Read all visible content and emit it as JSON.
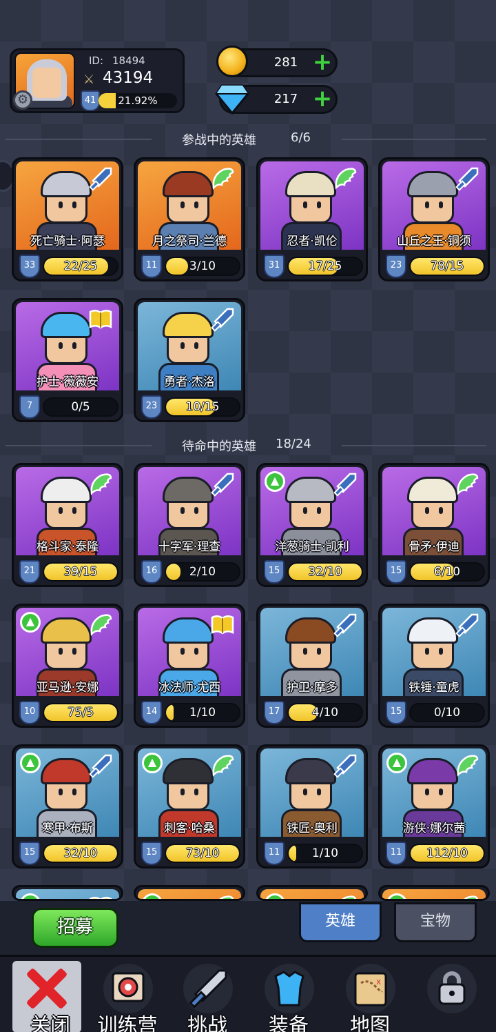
{
  "player": {
    "id_label": "ID:",
    "id": "18494",
    "power": "43194",
    "level": "41",
    "exp_text": "21.92%",
    "exp_fraction": 0.2192
  },
  "currency": {
    "coins": "281",
    "gems": "217",
    "add_symbol": "+"
  },
  "sections": {
    "active": {
      "title": "参战中的英雄",
      "count": "6/6"
    },
    "standby": {
      "title": "待命中的英雄",
      "count": "18/24"
    }
  },
  "active_heroes": [
    {
      "name": "死亡骑士·阿瑟",
      "level": "33",
      "progress": "22/25",
      "fraction": 0.88,
      "rarity": "orange",
      "type": "sword-icon",
      "upgrade": false,
      "hair": "#c7cad6",
      "body": "#3b4058"
    },
    {
      "name": "月之祭司·兰德",
      "level": "11",
      "progress": "3/10",
      "fraction": 0.3,
      "rarity": "orange",
      "type": "wing-icon",
      "upgrade": false,
      "hair": "#9a3a22",
      "body": "#5a7fb0"
    },
    {
      "name": "忍者·凯伦",
      "level": "31",
      "progress": "17/25",
      "fraction": 0.68,
      "rarity": "purple",
      "type": "wing-icon",
      "upgrade": false,
      "hair": "#e9e0c4",
      "body": "#2c3350"
    },
    {
      "name": "山丘之王·铜须",
      "level": "23",
      "progress": "78/15",
      "fraction": 1.0,
      "rarity": "purple",
      "type": "sword-icon",
      "upgrade": false,
      "hair": "#9aa0ad",
      "body": "#e88a2a"
    },
    {
      "name": "护士·薇薇安",
      "level": "7",
      "progress": "0/5",
      "fraction": 0.0,
      "rarity": "purple",
      "type": "book-icon",
      "upgrade": false,
      "hair": "#4ab6f0",
      "body": "#f48fb7"
    },
    {
      "name": "勇者·杰洛",
      "level": "23",
      "progress": "10/15",
      "fraction": 0.67,
      "rarity": "blue",
      "type": "sword-icon",
      "upgrade": false,
      "hair": "#f5d24a",
      "body": "#3e7fc4"
    }
  ],
  "standby_heroes": [
    {
      "name": "格斗家·泰隆",
      "level": "21",
      "progress": "39/15",
      "fraction": 1.0,
      "rarity": "purple",
      "type": "wing-icon",
      "upgrade": false,
      "hair": "#eeeeee",
      "body": "#c9542a"
    },
    {
      "name": "十字军·理查",
      "level": "16",
      "progress": "2/10",
      "fraction": 0.2,
      "rarity": "purple",
      "type": "sword-icon",
      "upgrade": false,
      "hair": "#6d6a66",
      "body": "#5b5650"
    },
    {
      "name": "洋葱骑士·凯利",
      "level": "15",
      "progress": "32/10",
      "fraction": 1.0,
      "rarity": "purple",
      "type": "sword-icon",
      "upgrade": true,
      "hair": "#b7bac2",
      "body": "#8b8f99"
    },
    {
      "name": "骨矛·伊迪",
      "level": "15",
      "progress": "6/10",
      "fraction": 0.6,
      "rarity": "purple",
      "type": "wing-icon",
      "upgrade": false,
      "hair": "#f0ead8",
      "body": "#7b4f38"
    },
    {
      "name": "亚马逊·安娜",
      "level": "10",
      "progress": "75/5",
      "fraction": 1.0,
      "rarity": "purple",
      "type": "wing-icon",
      "upgrade": true,
      "hair": "#e9c04a",
      "body": "#9b3a2a"
    },
    {
      "name": "冰法师·尤西",
      "level": "14",
      "progress": "1/10",
      "fraction": 0.1,
      "rarity": "purple",
      "type": "book-icon",
      "upgrade": false,
      "hair": "#4aa8e8",
      "body": "#4aa8e8"
    },
    {
      "name": "护卫·摩多",
      "level": "17",
      "progress": "4/10",
      "fraction": 0.4,
      "rarity": "blue",
      "type": "sword-icon",
      "upgrade": false,
      "hair": "#8a4a22",
      "body": "#8f949e"
    },
    {
      "name": "铁锤·童虎",
      "level": "15",
      "progress": "0/10",
      "fraction": 0.0,
      "rarity": "blue",
      "type": "sword-icon",
      "upgrade": false,
      "hair": "#eef1f6",
      "body": "#3b4a66"
    },
    {
      "name": "寒甲·布斯",
      "level": "15",
      "progress": "32/10",
      "fraction": 1.0,
      "rarity": "blue",
      "type": "sword-icon",
      "upgrade": true,
      "hair": "#c0392b",
      "body": "#aab0bd"
    },
    {
      "name": "刺客·哈桑",
      "level": "15",
      "progress": "73/10",
      "fraction": 1.0,
      "rarity": "blue",
      "type": "wing-icon",
      "upgrade": true,
      "hair": "#2f2f36",
      "body": "#c0392b"
    },
    {
      "name": "铁匠·奥利",
      "level": "11",
      "progress": "1/10",
      "fraction": 0.1,
      "rarity": "blue",
      "type": "sword-icon",
      "upgrade": false,
      "hair": "#3a3a4a",
      "body": "#8a5a30"
    },
    {
      "name": "游侠·娜尔茜",
      "level": "11",
      "progress": "112/10",
      "fraction": 1.0,
      "rarity": "blue",
      "type": "wing-icon",
      "upgrade": true,
      "hair": "#7a3aa8",
      "body": "#6a3a9a"
    }
  ],
  "partial_row": [
    {
      "rarity": "blue",
      "type": "book-icon",
      "upgrade": true
    },
    {
      "rarity": "orange",
      "type": "wing-icon",
      "upgrade": true
    },
    {
      "rarity": "orange",
      "type": "wing-icon",
      "upgrade": true
    },
    {
      "rarity": "orange",
      "type": "wing-icon",
      "upgrade": true
    }
  ],
  "actions": {
    "recruit": "招募"
  },
  "tabs": {
    "heroes": "英雄",
    "treasure": "宝物"
  },
  "nav": {
    "close": "关闭",
    "training": "训练营",
    "challenge": "挑战",
    "equipment": "装备",
    "map": "地图",
    "locked": ""
  },
  "colors": {
    "orange": "#ee8a2e",
    "purple": "#9a4fd8",
    "blue": "#5ea2cc",
    "progress": "#f5d23b",
    "upgrade": "#3cc43c"
  }
}
